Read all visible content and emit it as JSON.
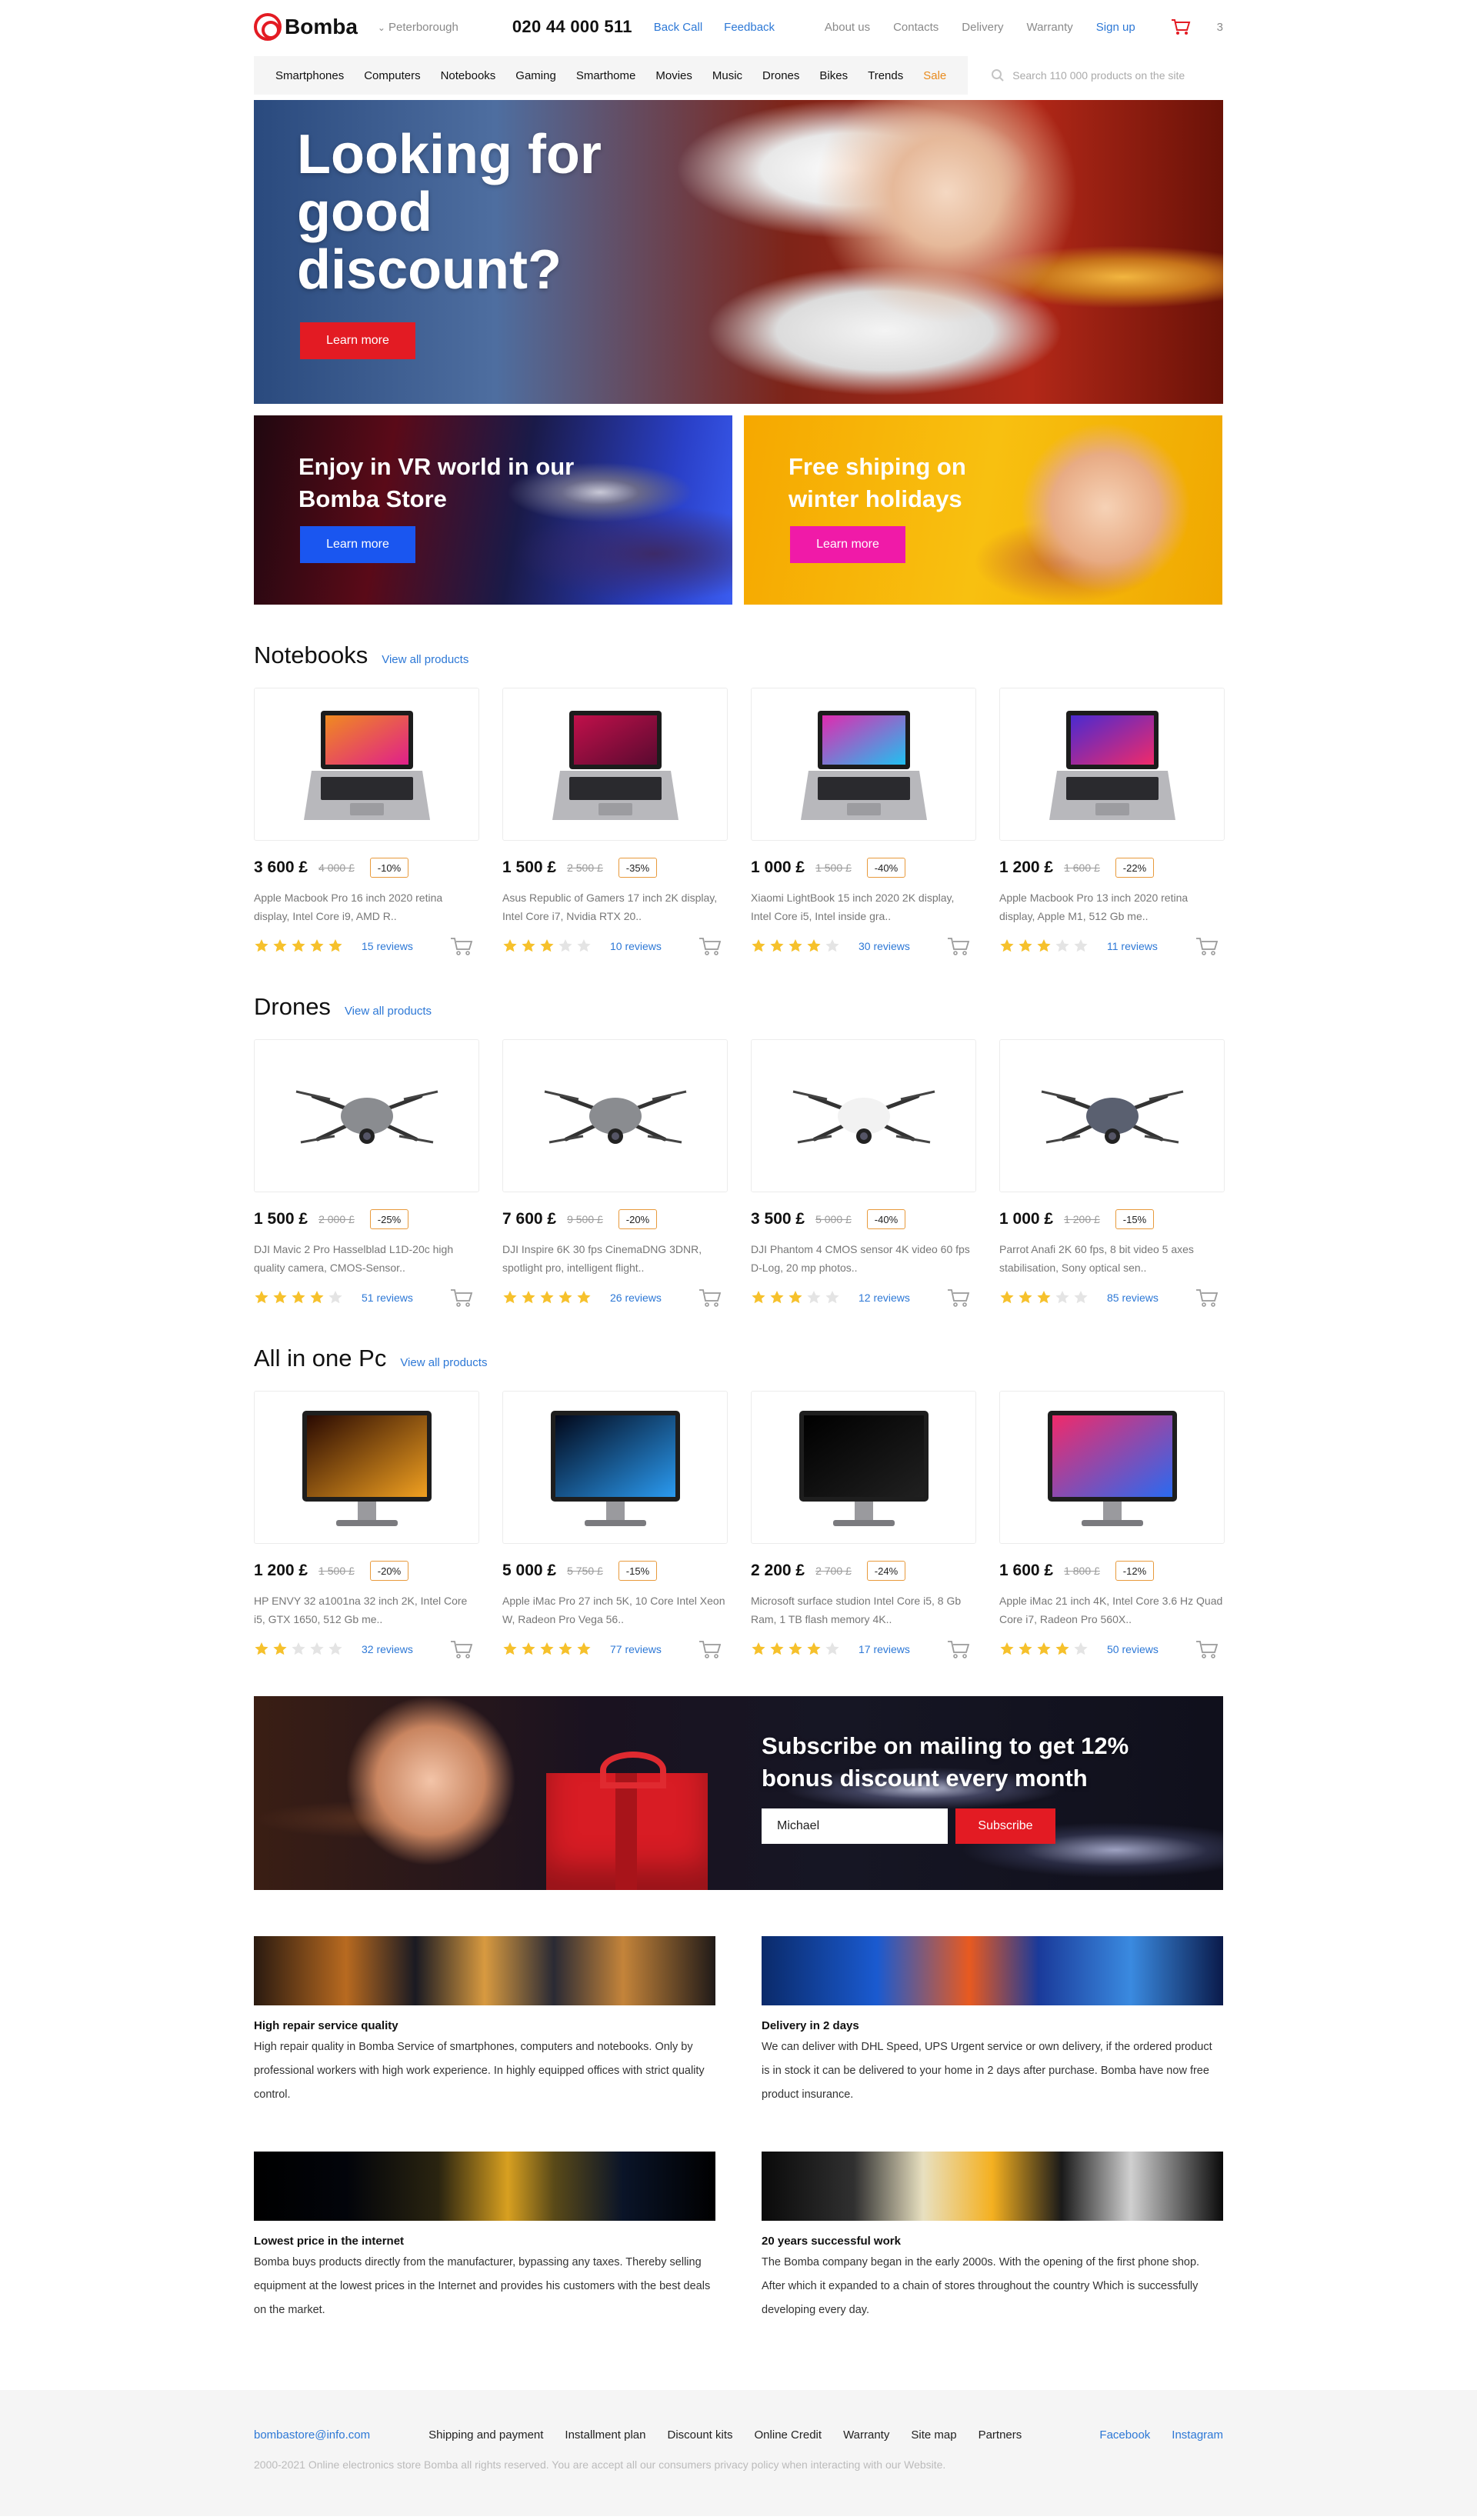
{
  "header": {
    "logo_text": "Bomba",
    "city": "Peterborough",
    "phone": "020 44 000 511",
    "back_call": "Back Call",
    "feedback": "Feedback",
    "nav": [
      "About us",
      "Contacts",
      "Delivery",
      "Warranty"
    ],
    "signup": "Sign up",
    "cart_count": "3"
  },
  "categories": [
    "Smartphones",
    "Computers",
    "Notebooks",
    "Gaming",
    "Smarthome",
    "Movies",
    "Music",
    "Drones",
    "Bikes",
    "Trends",
    "Sale"
  ],
  "search": {
    "placeholder": "Search 110 000 products on the site"
  },
  "hero": {
    "title": "Looking for good discount?",
    "button": "Learn more"
  },
  "promos": [
    {
      "title": "Enjoy in VR world in our Bomba Store",
      "button": "Learn more",
      "button_color": "#1a56f0"
    },
    {
      "title": "Free shiping on winter holidays",
      "button": "Learn more",
      "button_color": "#f01aa8"
    }
  ],
  "view_all": "View all products",
  "sections": [
    {
      "title": "Notebooks",
      "products": [
        {
          "image": "laptop-macbook-image",
          "price": "3 600 £",
          "old_price": "4 000 £",
          "discount": "-10%",
          "description": "Apple Macbook Pro 16 inch 2020 retina display, Intel Core i9, AMD R..",
          "rating": 5,
          "reviews": "15 reviews"
        },
        {
          "image": "laptop-gaming-image",
          "price": "1 500 £",
          "old_price": "2 500 £",
          "discount": "-35%",
          "description": "Asus Republic of Gamers 17 inch 2K display, Intel Core i7, Nvidia RTX 20..",
          "rating": 3,
          "reviews": "10 reviews"
        },
        {
          "image": "laptop-xiaomi-image",
          "price": "1 000 £",
          "old_price": "1 500 £",
          "discount": "-40%",
          "description": "Xiaomi LightBook 15 inch 2020 2K display, Intel Core i5, Intel inside gra..",
          "rating": 4,
          "reviews": "30 reviews"
        },
        {
          "image": "laptop-macbook13-image",
          "price": "1 200 £",
          "old_price": "1 600 £",
          "discount": "-22%",
          "description": "Apple Macbook Pro 13 inch 2020 retina display, Apple M1, 512 Gb me..",
          "rating": 3,
          "reviews": "11 reviews"
        }
      ]
    },
    {
      "title": "Drones",
      "products": [
        {
          "image": "drone-mavic-image",
          "price": "1 500 £",
          "old_price": "2 000 £",
          "discount": "-25%",
          "description": "DJI Mavic 2 Pro Hasselblad L1D-20c high quality camera, CMOS-Sensor..",
          "rating": 4,
          "reviews": "51 reviews"
        },
        {
          "image": "drone-inspire-image",
          "price": "7 600 £",
          "old_price": "9 500 £",
          "discount": "-20%",
          "description": "DJI Inspire 6K 30 fps CinemaDNG 3DNR, spotlight pro, intelligent flight..",
          "rating": 5,
          "reviews": "26 reviews"
        },
        {
          "image": "drone-phantom-image",
          "price": "3 500 £",
          "old_price": "5 000 £",
          "discount": "-40%",
          "description": "DJI Phantom 4 CMOS sensor 4K video 60 fps D-Log, 20 mp photos..",
          "rating": 3,
          "reviews": "12 reviews"
        },
        {
          "image": "drone-anafi-image",
          "price": "1 000 £",
          "old_price": "1 200 £",
          "discount": "-15%",
          "description": "Parrot Anafi 2K 60 fps, 8 bit video 5 axes stabilisation, Sony optical sen..",
          "rating": 3,
          "reviews": "85 reviews"
        }
      ]
    },
    {
      "title": "All in one Pc",
      "products": [
        {
          "image": "aio-hp-image",
          "price": "1 200 £",
          "old_price": "1 500 £",
          "discount": "-20%",
          "description": "HP ENVY 32 a1001na 32 inch 2K, Intel Core i5, GTX 1650, 512 Gb me..",
          "rating": 2,
          "reviews": "32 reviews"
        },
        {
          "image": "aio-imacpro-image",
          "price": "5 000 £",
          "old_price": "5 750 £",
          "discount": "-15%",
          "description": "Apple iMac Pro 27 inch 5K, 10 Core Intel Xeon W, Radeon Pro Vega 56..",
          "rating": 5,
          "reviews": "77 reviews"
        },
        {
          "image": "aio-surface-image",
          "price": "2 200 £",
          "old_price": "2 700 £",
          "discount": "-24%",
          "description": "Microsoft surface studion Intel Core i5, 8 Gb Ram, 1 TB flash memory 4K..",
          "rating": 4,
          "reviews": "17 reviews"
        },
        {
          "image": "aio-imac-image",
          "price": "1 600 £",
          "old_price": "1 800 £",
          "discount": "-12%",
          "description": "Apple iMac 21 inch 4K, Intel Core 3.6 Hz Quad Core i7, Radeon Pro 560X..",
          "rating": 4,
          "reviews": "50 reviews"
        }
      ]
    }
  ],
  "subscribe": {
    "title": "Subscribe on mailing to get 12% bonus discount every month",
    "input_value": "Michael",
    "button": "Subscribe"
  },
  "features": [
    {
      "title": "High repair service quality",
      "text": "High repair quality in Bomba Service of smartphones, computers and notebooks. Only by professional workers with high work experience. In highly equipped offices with strict quality control."
    },
    {
      "title": "Delivery in 2 days",
      "text": "We can deliver with DHL Speed, UPS Urgent service or own delivery, if the ordered product is in stock it can be delivered to your home in 2 days after purchase. Bomba have now free product insurance."
    },
    {
      "title": "Lowest price in the internet",
      "text": "Bomba buys products directly from the manufacturer, bypassing any taxes. Thereby selling equipment at the lowest prices in the Internet and provides his customers with the best deals on the market."
    },
    {
      "title": "20 years successful work",
      "text": "The Bomba company began in the early 2000s. With the opening of the first phone shop. After which it expanded to a chain of stores throughout the country Which is successfully developing every day."
    }
  ],
  "footer": {
    "email": "bombastore@info.com",
    "links": [
      "Shipping and payment",
      "Installment plan",
      "Discount kits",
      "Online Credit",
      "Warranty",
      "Site map",
      "Partners"
    ],
    "social": [
      "Facebook",
      "Instagram"
    ],
    "copyright": "2000-2021 Online electronics store Bomba all rights reserved. You are accept all our consumers privacy policy when interacting with our Website."
  },
  "colors": {
    "accent_red": "#e31b23",
    "link_blue": "#2d78d6",
    "star_yellow": "#f6c12c",
    "star_empty": "#e4e4e4",
    "badge_border": "#e89a3c",
    "sale_orange": "#e88a1c"
  }
}
